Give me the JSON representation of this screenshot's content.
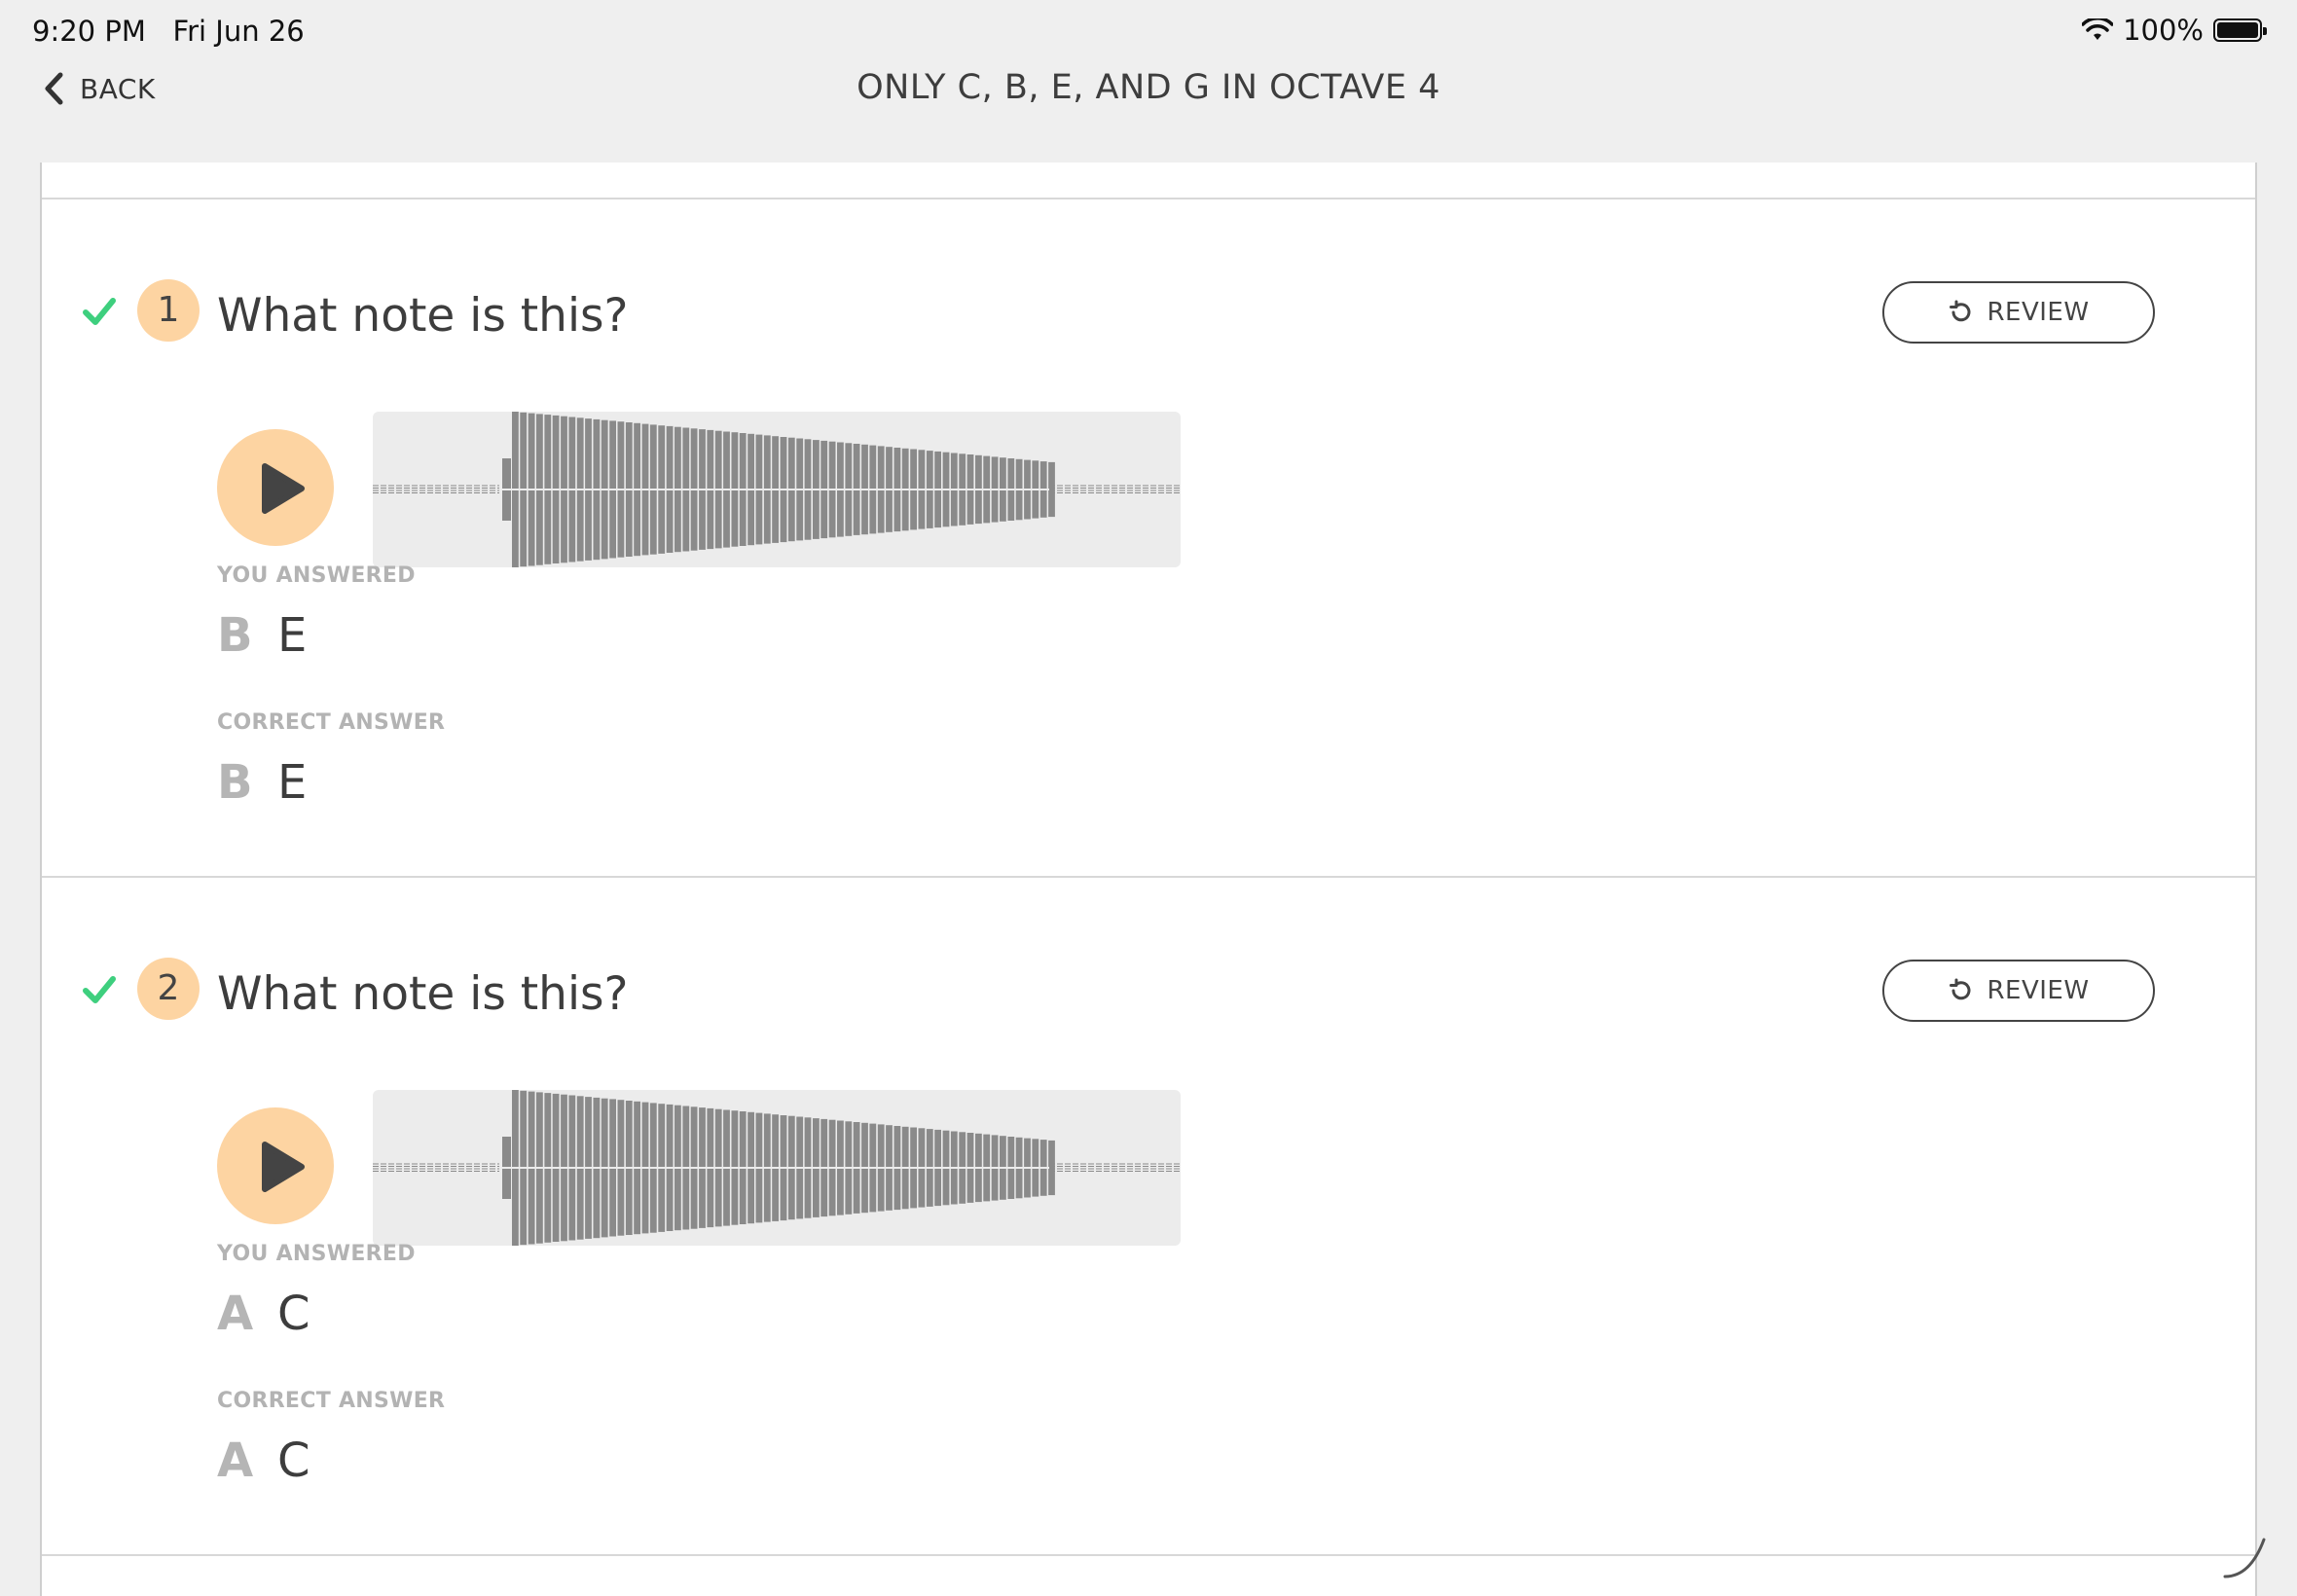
{
  "status": {
    "time": "9:20 PM",
    "date": "Fri Jun 26",
    "battery": "100%",
    "battery_level": 1.0
  },
  "nav": {
    "back_label": "BACK",
    "title": "ONLY C, B, E, AND G IN OCTAVE 4"
  },
  "questions": [
    {
      "number": "1",
      "prompt": "What note is this?",
      "review_label": "REVIEW",
      "you_answered_label": "YOU ANSWERED",
      "you_answered_letter": "B",
      "you_answered_note": "E",
      "correct_answer_label": "CORRECT ANSWER",
      "correct_letter": "B",
      "correct_note": "E",
      "is_correct": true
    },
    {
      "number": "2",
      "prompt": "What note is this?",
      "review_label": "REVIEW",
      "you_answered_label": "YOU ANSWERED",
      "you_answered_letter": "A",
      "you_answered_note": "C",
      "correct_answer_label": "CORRECT ANSWER",
      "correct_letter": "A",
      "correct_note": "C",
      "is_correct": true
    }
  ],
  "colors": {
    "accent": "#fdd4a2",
    "check": "#3ecf7e",
    "waveform": "#8a8a8a"
  }
}
